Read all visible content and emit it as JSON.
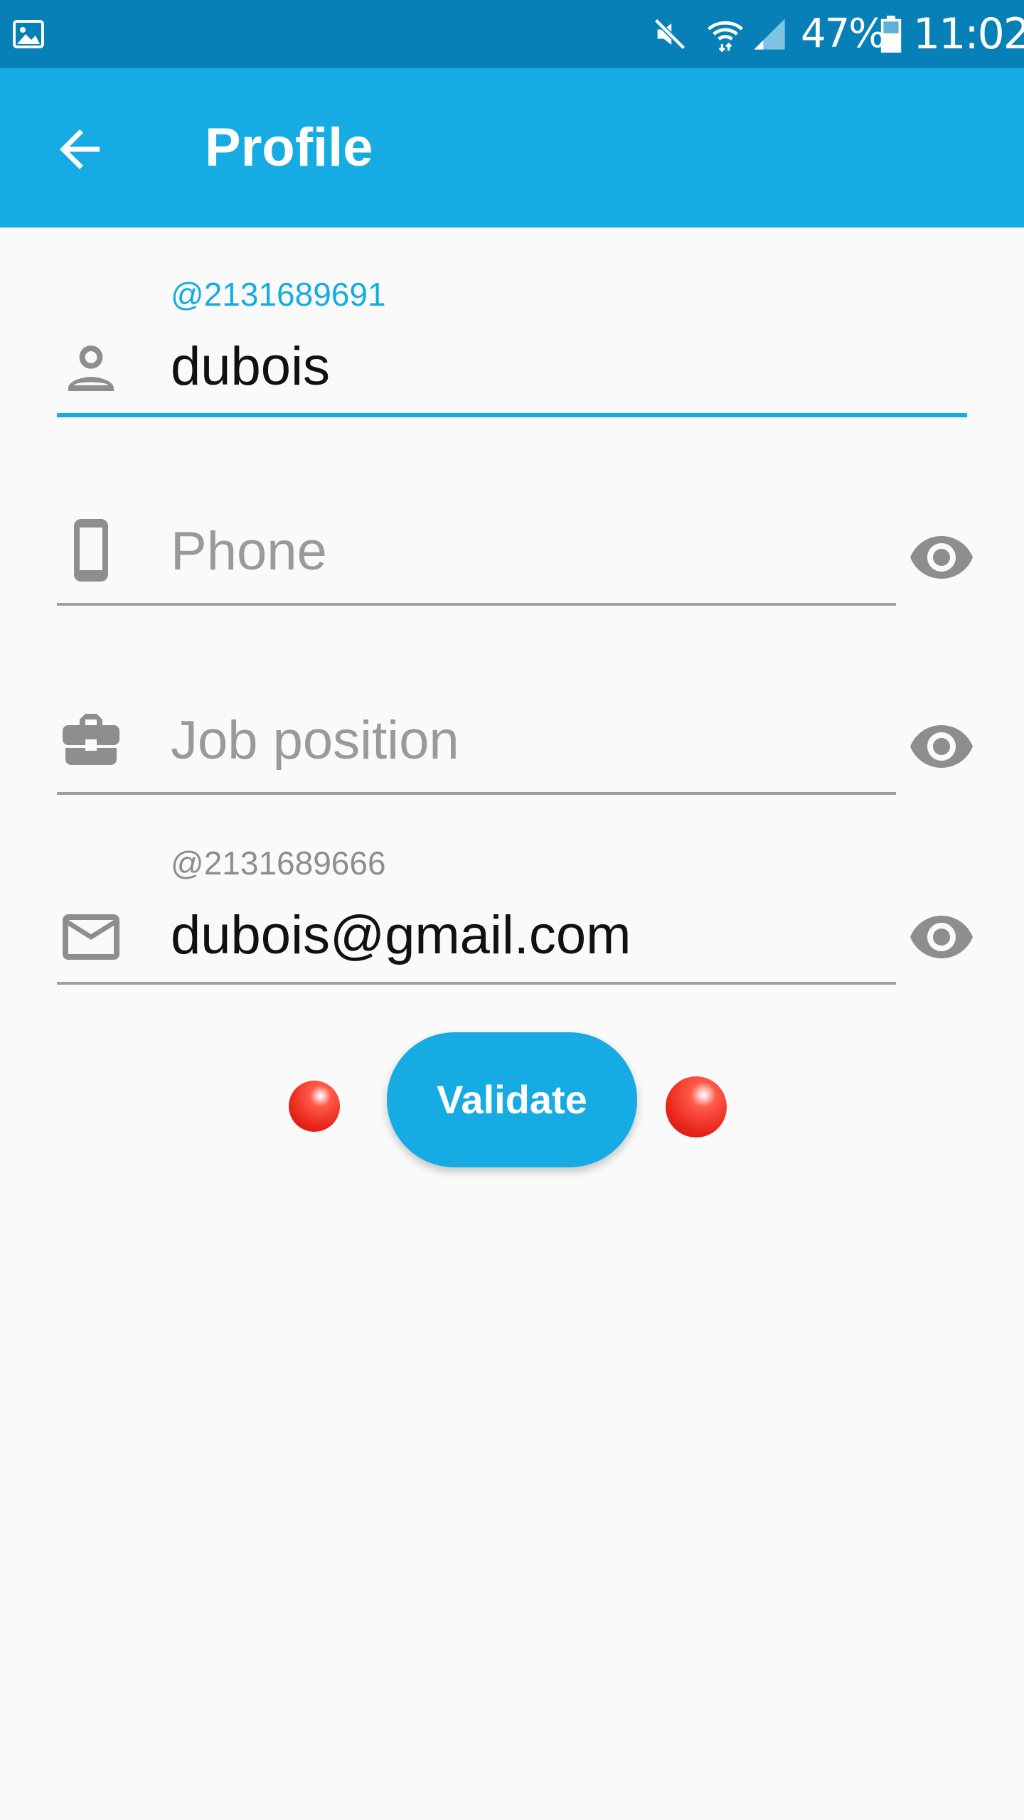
{
  "status_bar": {
    "battery_percent": "47%",
    "time": "11:02",
    "icons": [
      "gallery-icon",
      "mute-icon",
      "wifi-icon",
      "signal-icon",
      "battery-icon"
    ]
  },
  "app_bar": {
    "title": "Profile",
    "back_icon": "arrow-back-icon",
    "background_color": "#16ace3"
  },
  "form": {
    "name": {
      "helper": "@2131689691",
      "value": "dubois",
      "icon": "person-icon"
    },
    "phone": {
      "placeholder": "Phone",
      "icon": "phone-icon",
      "visibility_icon": "eye-icon"
    },
    "job": {
      "placeholder": "Job position",
      "icon": "briefcase-icon",
      "visibility_icon": "eye-icon"
    },
    "email": {
      "helper": "@2131689666",
      "value": "dubois@gmail.com",
      "icon": "mail-icon",
      "visibility_icon": "eye-icon"
    }
  },
  "actions": {
    "validate_label": "Validate"
  },
  "colors": {
    "accent": "#16ace3",
    "status_bar": "#0680b6",
    "icon_gray": "#8e8e8e"
  }
}
